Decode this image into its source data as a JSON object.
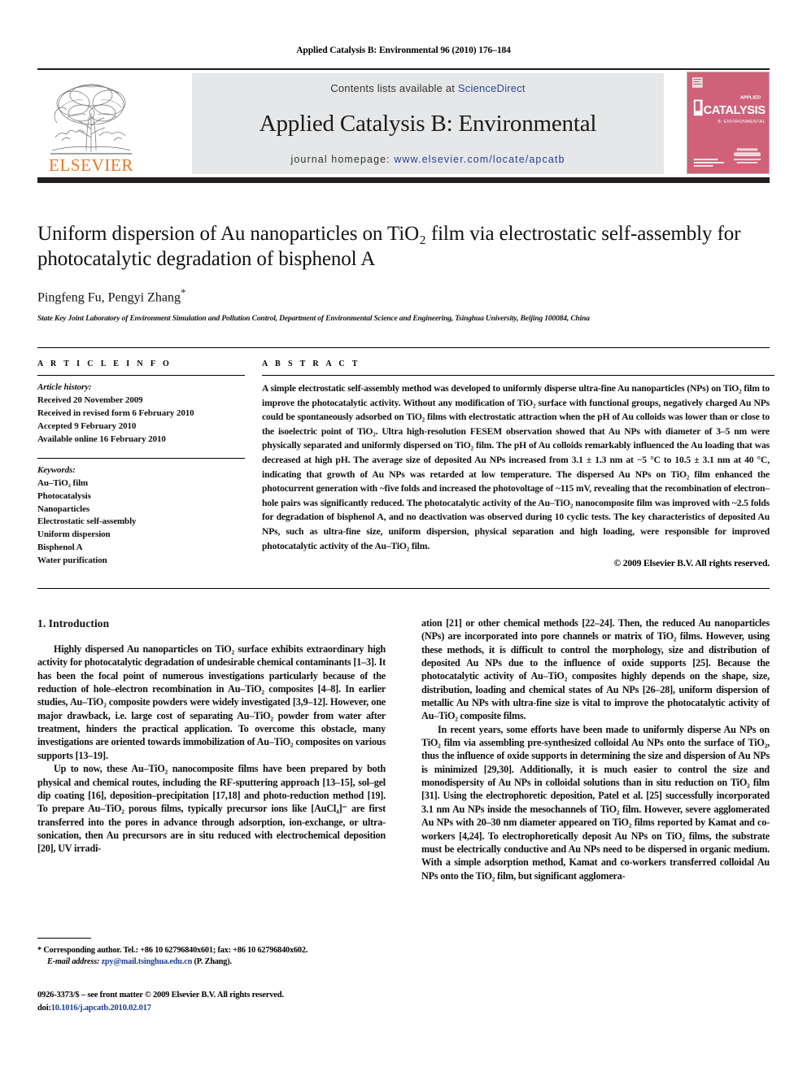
{
  "running_head": "Applied Catalysis B: Environmental 96 (2010) 176–184",
  "masthead": {
    "publisher_name": "ELSEVIER",
    "contents_prefix": "Contents lists available at ",
    "contents_link": "ScienceDirect",
    "journal_title": "Applied Catalysis B: Environmental",
    "homepage_prefix": "journal homepage: ",
    "homepage_url": "www.elsevier.com/locate/apcatb",
    "cover_title": "CATALYSIS",
    "cover_subtitle": "B: ENVIRONMENTAL",
    "cover_color": "#cf6179",
    "brand_orange": "#e87722",
    "link_blue": "#2a3f99"
  },
  "article": {
    "title": "Uniform dispersion of Au nanoparticles on TiO₂ film via electrostatic self-assembly for photocatalytic degradation of bisphenol A",
    "authors": "Pingfeng Fu, Pengyi Zhang",
    "corresponding_marker": "*",
    "affiliation": "State Key Joint Laboratory of Environment Simulation and Pollution Control, Department of Environmental Science and Engineering, Tsinghua University, Beijing 100084, China"
  },
  "info": {
    "heading": "A R T I C L E    I N F O",
    "history_label": "Article history:",
    "history": [
      "Received 20 November 2009",
      "Received in revised form 6 February 2010",
      "Accepted 9 February 2010",
      "Available online 16 February 2010"
    ],
    "keywords_label": "Keywords:",
    "keywords": [
      "Au–TiO₂ film",
      "Photocatalysis",
      "Nanoparticles",
      "Electrostatic self-assembly",
      "Uniform dispersion",
      "Bisphenol A",
      "Water purification"
    ]
  },
  "abstract": {
    "heading": "A B S T R A C T",
    "text": "A simple electrostatic self-assembly method was developed to uniformly disperse ultra-fine Au nanoparticles (NPs) on TiO₂ film to improve the photocatalytic activity. Without any modification of TiO₂ surface with functional groups, negatively charged Au NPs could be spontaneously adsorbed on TiO₂ films with electrostatic attraction when the pH of Au colloids was lower than or close to the isoelectric point of TiO₂. Ultra high-resolution FESEM observation showed that Au NPs with diameter of 3–5 nm were physically separated and uniformly dispersed on TiO₂ film. The pH of Au colloids remarkably influenced the Au loading that was decreased at high pH. The average size of deposited Au NPs increased from 3.1 ± 1.3 nm at −5 °C to 10.5 ± 3.1 nm at 40 °C, indicating that growth of Au NPs was retarded at low temperature. The dispersed Au NPs on TiO₂ film enhanced the photocurrent generation with ~five folds and increased the photovoltage of ~115 mV, revealing that the recombination of electron–hole pairs was significantly reduced. The photocatalytic activity of the Au–TiO₂ nanocomposite film was improved with ~2.5 folds for degradation of bisphenol A, and no deactivation was observed during 10 cyclic tests. The key characteristics of deposited Au NPs, such as ultra-fine size, uniform dispersion, physical separation and high loading, were responsible for improved photocatalytic activity of the Au–TiO₂ film.",
    "copyright": "© 2009 Elsevier B.V. All rights reserved."
  },
  "body": {
    "section_number_title": "1.  Introduction",
    "left_paragraphs": [
      "Highly dispersed Au nanoparticles on TiO₂ surface exhibits extraordinary high activity for photocatalytic degradation of undesirable chemical contaminants [1–3]. It has been the focal point of numerous investigations particularly because of the reduction of hole–electron recombination in Au–TiO₂ composites [4–8]. In earlier studies, Au–TiO₂ composite powders were widely investigated [3,9–12]. However, one major drawback, i.e. large cost of separating Au–TiO₂ powder from water after treatment, hinders the practical application. To overcome this obstacle, many investigations are oriented towards immobilization of Au–TiO₂ composites on various supports [13–19].",
      "Up to now, these Au–TiO₂ nanocomposite films have been prepared by both physical and chemical routes, including the RF-sputtering approach [13–15], sol–gel dip coating [16], deposition–precipitation [17,18] and photo-reduction method [19]. To prepare Au–TiO₂ porous films, typically precursor ions like [AuCl₄]⁻ are first transferred into the pores in advance through adsorption, ion-exchange, or ultra-sonication, then Au precursors are in situ reduced with electrochemical deposition [20], UV irradi-"
    ],
    "right_paragraphs": [
      "ation [21] or other chemical methods [22–24]. Then, the reduced Au nanoparticles (NPs) are incorporated into pore channels or matrix of TiO₂ films. However, using these methods, it is difficult to control the morphology, size and distribution of deposited Au NPs due to the influence of oxide supports [25]. Because the photocatalytic activity of Au–TiO₂ composites highly depends on the shape, size, distribution, loading and chemical states of Au NPs [26–28], uniform dispersion of metallic Au NPs with ultra-fine size is vital to improve the photocatalytic activity of Au–TiO₂ composite films.",
      "In recent years, some efforts have been made to uniformly disperse Au NPs on TiO₂ film via assembling pre-synthesized colloidal Au NPs onto the surface of TiO₂, thus the influence of oxide supports in determining the size and dispersion of Au NPs is minimized [29,30]. Additionally, it is much easier to control the size and monodispersity of Au NPs in colloidal solutions than in situ reduction on TiO₂ film [31]. Using the electrophoretic deposition, Patel et al. [25] successfully incorporated 3.1 nm Au NPs inside the mesochannels of TiO₂ film. However, severe agglomerated Au NPs with 20–30 nm diameter appeared on TiO₂ films reported by Kamat and co-workers [4,24]. To electrophoretically deposit Au NPs on TiO₂ films, the substrate must be electrically conductive and Au NPs need to be dispersed in organic medium. With a simple adsorption method, Kamat and co-workers transferred colloidal Au NPs onto the TiO₂ film, but significant agglomera-"
    ]
  },
  "footnote": {
    "line1": "* Corresponding author. Tel.: +86 10 62796840x601; fax: +86 10 62796840x602.",
    "email_label": "E-mail address: ",
    "email": "zpy@mail.tsinghua.edu.cn",
    "email_suffix": " (P. Zhang)."
  },
  "imprint": {
    "line1": "0926-3373/$ – see front matter © 2009 Elsevier B.V. All rights reserved.",
    "doi_label": "doi:",
    "doi_value": "10.1016/j.apcatb.2010.02.017"
  }
}
